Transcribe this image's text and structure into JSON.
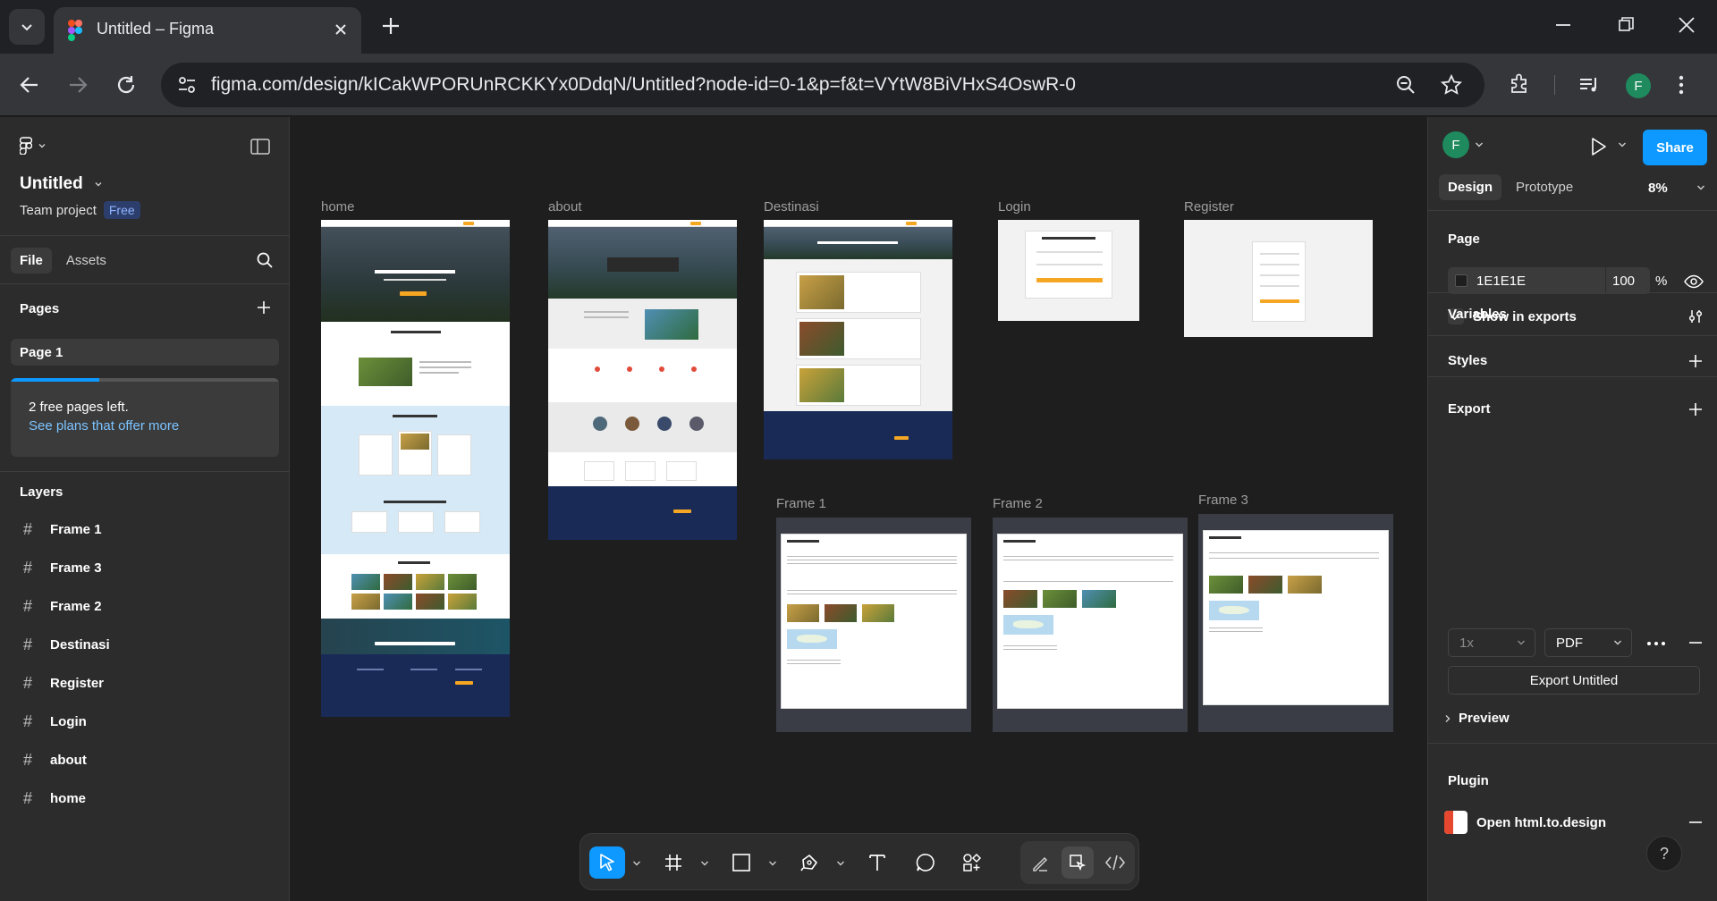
{
  "browser": {
    "tab_title": "Untitled – Figma",
    "url": "figma.com/design/kICakWPORUnRCKKYx0DdqN/Untitled?node-id=0-1&p=f&t=VYtW8BiVHxS4OswR-0",
    "profile_initial": "F"
  },
  "left_panel": {
    "file_name": "Untitled",
    "team": "Team project",
    "plan_badge": "Free",
    "tabs": [
      "File",
      "Assets"
    ],
    "pages_title": "Pages",
    "current_page": "Page 1",
    "upsell_text": "2 free pages left.",
    "upsell_link": "See plans that offer more",
    "free_pages_progress": 0.33,
    "layers_title": "Layers",
    "layers": [
      "Frame 1",
      "Frame 3",
      "Frame 2",
      "Destinasi",
      "Register",
      "Login",
      "about",
      "home"
    ]
  },
  "right_panel": {
    "avatar": "F",
    "share": "Share",
    "tabs": [
      "Design",
      "Prototype"
    ],
    "zoom": "8%",
    "page_title": "Page",
    "bg_hex": "1E1E1E",
    "bg_opacity": "100",
    "bg_percent": "%",
    "show_in_exports": "Show in exports",
    "variables": "Variables",
    "styles": "Styles",
    "export": "Export",
    "export_scale": "1x",
    "export_format": "PDF",
    "export_button": "Export Untitled",
    "preview": "Preview",
    "plugin_title": "Plugin",
    "plugin_name": "Open html.to.design",
    "help": "?"
  },
  "canvas": {
    "frames": [
      "home",
      "about",
      "Destinasi",
      "Login",
      "Register",
      "Frame 1",
      "Frame 2",
      "Frame 3"
    ]
  },
  "colors": {
    "accent": "#0d99ff",
    "canvas_bg": "#1e1e1e",
    "panel_bg": "#2c2c2c",
    "footer_navy": "#1a2a57",
    "brand_orange": "#f5a623"
  }
}
